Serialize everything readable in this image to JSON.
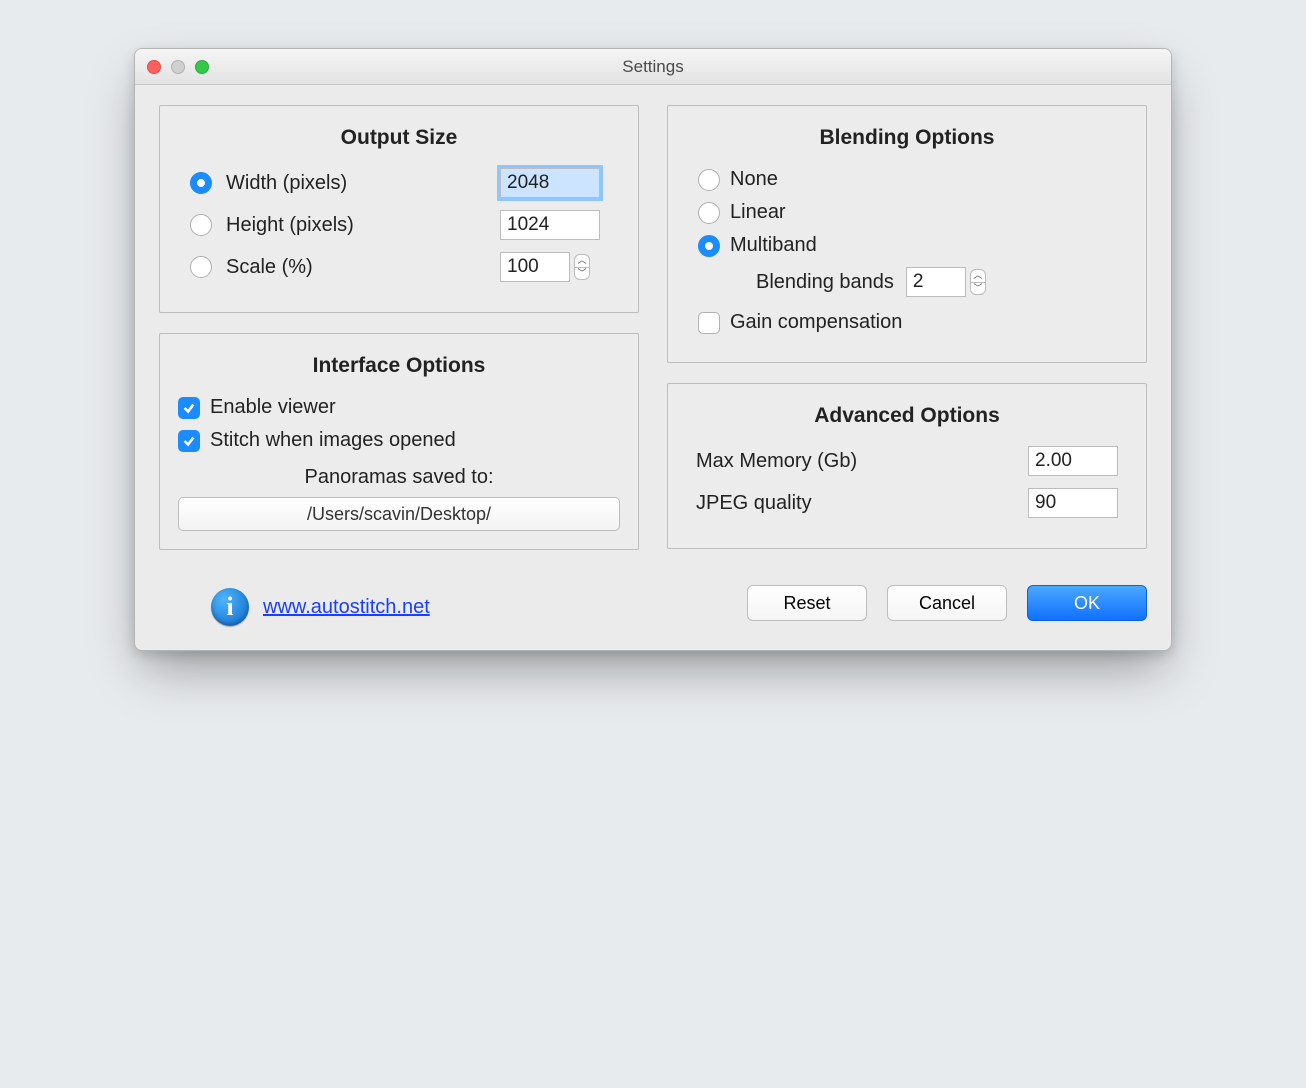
{
  "window": {
    "title": "Settings"
  },
  "outputSize": {
    "title": "Output Size",
    "width_label": "Width (pixels)",
    "width_value": "2048",
    "height_label": "Height (pixels)",
    "height_value": "1024",
    "scale_label": "Scale (%)",
    "scale_value": "100",
    "selected": "width"
  },
  "interface": {
    "title": "Interface Options",
    "enable_viewer_label": "Enable viewer",
    "enable_viewer_checked": true,
    "stitch_label": "Stitch when images opened",
    "stitch_checked": true,
    "saved_to_label": "Panoramas saved to:",
    "saved_to_path": "/Users/scavin/Desktop/"
  },
  "link": {
    "text": "www.autostitch.net"
  },
  "blending": {
    "title": "Blending Options",
    "none_label": "None",
    "linear_label": "Linear",
    "multiband_label": "Multiband",
    "selected": "multiband",
    "bands_label": "Blending bands",
    "bands_value": "2",
    "gain_label": "Gain compensation",
    "gain_checked": false
  },
  "advanced": {
    "title": "Advanced Options",
    "max_memory_label": "Max Memory (Gb)",
    "max_memory_value": "2.00",
    "jpeg_label": "JPEG quality",
    "jpeg_value": "90"
  },
  "buttons": {
    "reset": "Reset",
    "cancel": "Cancel",
    "ok": "OK"
  }
}
